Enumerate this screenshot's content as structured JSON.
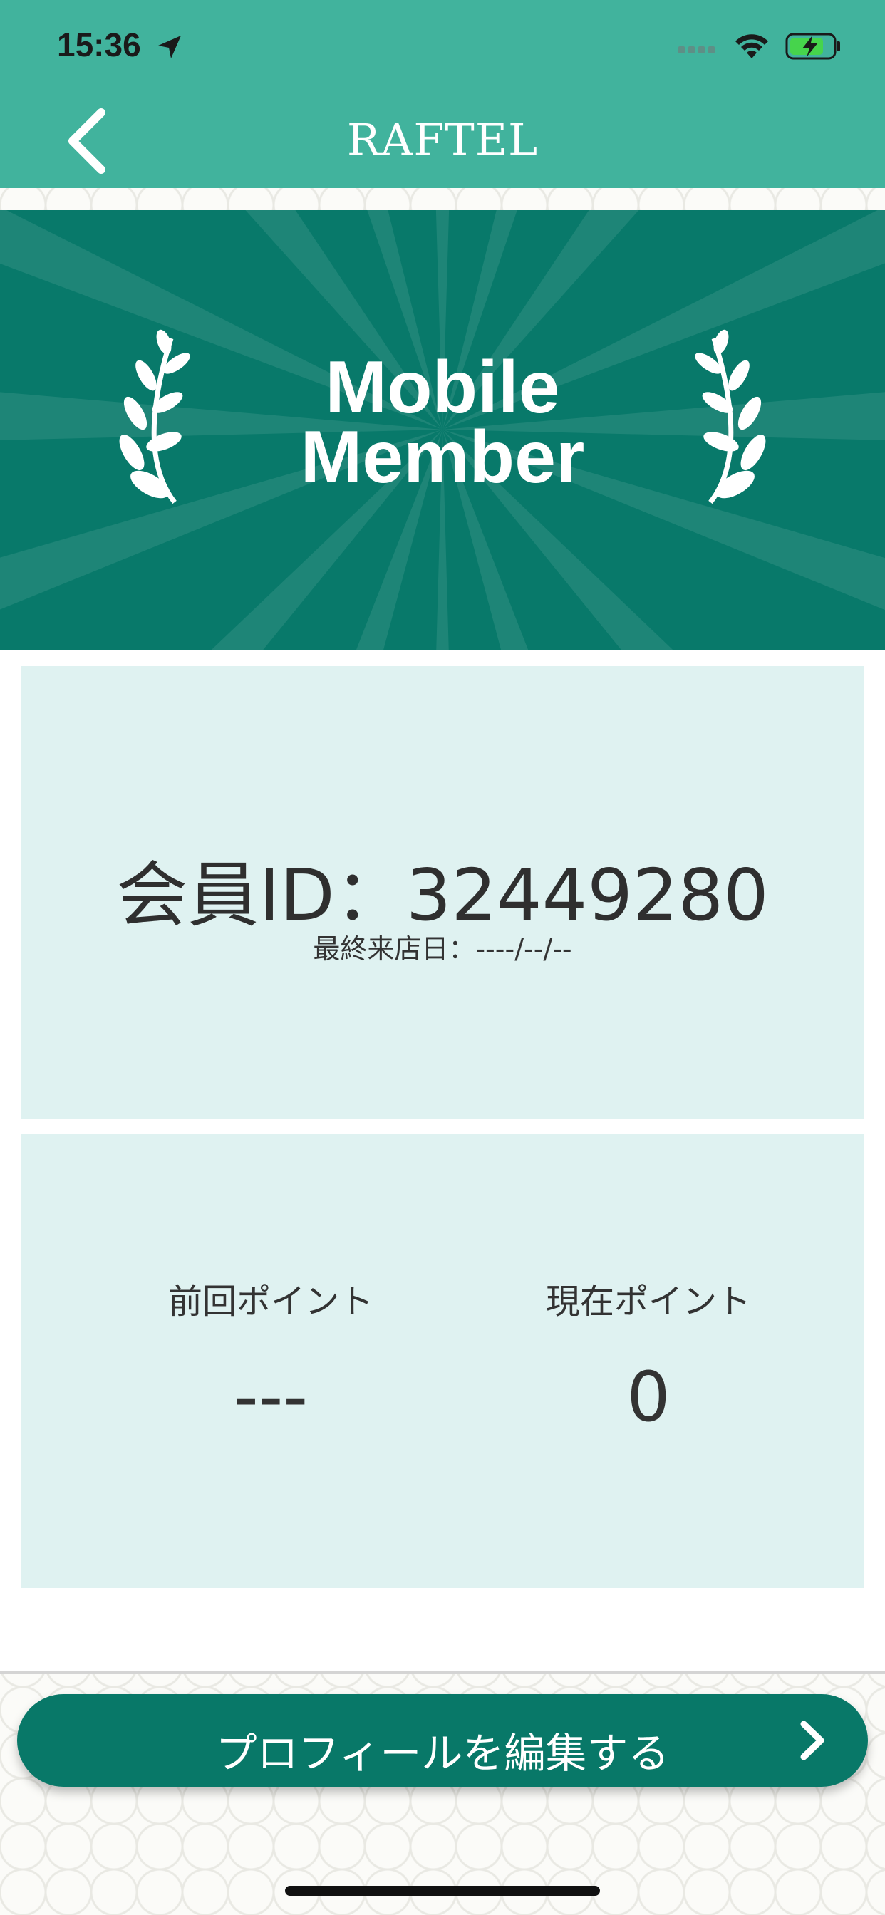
{
  "status": {
    "time": "15:36"
  },
  "nav": {
    "title": "RAFTEL"
  },
  "banner": {
    "line1": "Mobile",
    "line2": "Member"
  },
  "member": {
    "id_text": "会員ID：32449280",
    "last_visit": "最終来店日：----/--/--"
  },
  "points": {
    "previous_label": "前回ポイント",
    "previous_value": "---",
    "current_label": "現在ポイント",
    "current_value": "0"
  },
  "actions": {
    "edit_profile": "プロフィールを編集する"
  },
  "colors": {
    "header": "#41b39d",
    "banner": "#08796a",
    "card": "#dff2f1",
    "button": "#087868"
  }
}
